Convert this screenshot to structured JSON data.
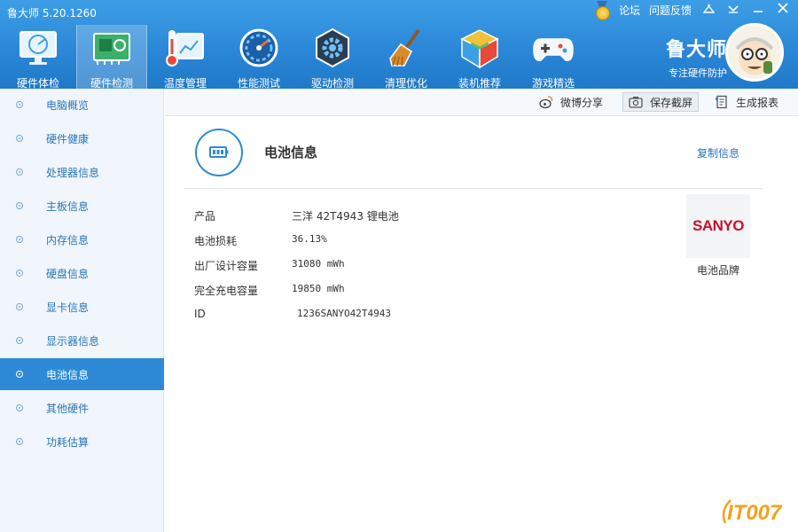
{
  "app": {
    "title": "鲁大师 5.20.1260"
  },
  "top_links": {
    "forum": "论坛",
    "feedback": "问题反馈"
  },
  "toolbar_main": [
    {
      "label": "硬件体检",
      "icon": "monitor-radar-icon"
    },
    {
      "label": "硬件检测",
      "icon": "circuit-board-icon"
    },
    {
      "label": "温度管理",
      "icon": "thermometer-icon"
    },
    {
      "label": "性能测试",
      "icon": "speedometer-icon"
    },
    {
      "label": "驱动检测",
      "icon": "gear-icon"
    },
    {
      "label": "清理优化",
      "icon": "broom-icon"
    },
    {
      "label": "装机推荐",
      "icon": "cube-icon"
    },
    {
      "label": "游戏精选",
      "icon": "gamepad-icon"
    }
  ],
  "brand": {
    "name": "鲁大师",
    "slogan": "专注硬件防护"
  },
  "sidebar": {
    "items": [
      {
        "label": "电脑概览"
      },
      {
        "label": "硬件健康"
      },
      {
        "label": "处理器信息"
      },
      {
        "label": "主板信息"
      },
      {
        "label": "内存信息"
      },
      {
        "label": "硬盘信息"
      },
      {
        "label": "显卡信息"
      },
      {
        "label": "显示器信息"
      },
      {
        "label": "电池信息"
      },
      {
        "label": "其他硬件"
      },
      {
        "label": "功耗估算"
      }
    ],
    "active_index": 8
  },
  "content_toolbar": {
    "share": "微博分享",
    "save_screenshot": "保存截屏",
    "generate_report": "生成报表"
  },
  "section": {
    "title": "电池信息",
    "copy": "复制信息"
  },
  "battery": {
    "rows": [
      {
        "key": "产品",
        "value": "三洋 42T4943 锂电池"
      },
      {
        "key": "电池损耗",
        "value": "36.13%"
      },
      {
        "key": "出厂设计容量",
        "value": "31080 mWh"
      },
      {
        "key": "完全充电容量",
        "value": "19850 mWh"
      },
      {
        "key": "ID",
        "value": "1236SANYO42T4943"
      }
    ],
    "brand_logo_text": "SANYO",
    "brand_label": "电池品牌"
  },
  "watermark": {
    "text": "IT007"
  },
  "colors": {
    "header": "#2a86d6",
    "accent": "#2e8ad6",
    "sidebar_bg": "#f0f6fb",
    "link": "#2a76b7",
    "sanyo_red": "#c8102e"
  }
}
